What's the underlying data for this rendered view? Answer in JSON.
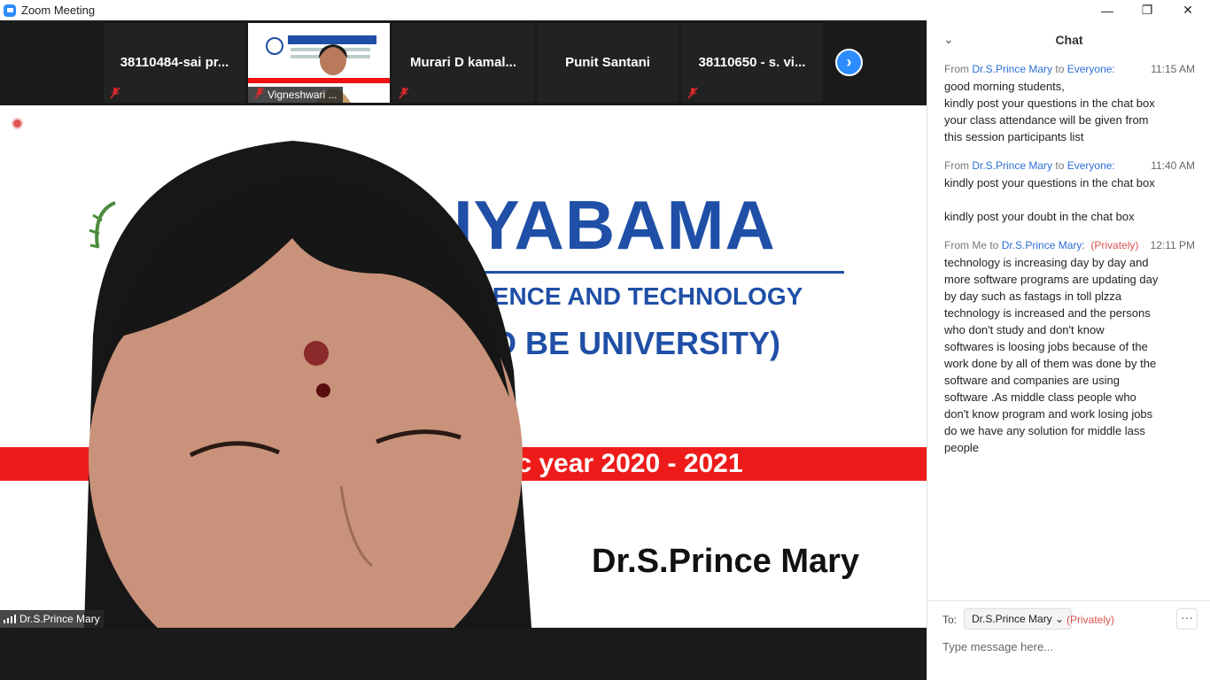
{
  "window": {
    "title": "Zoom Meeting",
    "minimize_glyph": "—",
    "maximize_glyph": "❐",
    "close_glyph": "✕"
  },
  "participants_strip": {
    "tiles": [
      {
        "name": "38110484-sai pr..."
      },
      {
        "name": "Vigneshwari ...",
        "video": true
      },
      {
        "name": "Murari  D  kamal..."
      },
      {
        "name": "Punit Santani"
      },
      {
        "name": "38110650 - s. vi..."
      }
    ],
    "next_glyph": "›"
  },
  "main_video": {
    "speaker_name": "Dr.S.Prince Mary",
    "slide": {
      "title_fragment": "IYABAMA",
      "sub1_fragment": "IENCE AND TECHNOLOGY",
      "sub2_fragment": "O BE UNIVERSITY)",
      "year_fragment": "ic year 2020 - 2021",
      "presenter": "Dr.S.Prince Mary"
    }
  },
  "chat": {
    "title": "Chat",
    "collapse_glyph": "⌄",
    "messages": [
      {
        "from_prefix": "From ",
        "sender": "Dr.S.Prince Mary",
        "to_word": " to ",
        "recipient": "Everyone:",
        "privately": "",
        "time": "11:15 AM",
        "lines": [
          "good morning students,",
          "kindly post your questions in the chat box",
          "your class attendance will be given from",
          "this session participants list"
        ]
      },
      {
        "from_prefix": "From ",
        "sender": "Dr.S.Prince Mary",
        "to_word": " to ",
        "recipient": "Everyone:",
        "privately": "",
        "time": "11:40 AM",
        "lines": [
          "kindly post your questions in the chat box",
          "",
          "kindly post your doubt in the chat box"
        ]
      },
      {
        "from_prefix": "From Me to ",
        "sender": "",
        "to_word": "",
        "recipient": "Dr.S.Prince Mary:",
        "privately": "(Privately)",
        "time": "12:11 PM",
        "lines": [
          "technology is increasing day by day and",
          "more software programs are updating day",
          "by day such as fastags in toll plzza",
          "technology is increased and the persons",
          "who don't study and don't know",
          "softwares is loosing jobs because of the",
          "work done by all of them was done by the",
          "software and companies are using",
          "software .As middle class people who",
          "don't know program and work losing jobs",
          "do we have any solution for middle lass",
          "people"
        ]
      }
    ],
    "footer": {
      "to_label": "To:",
      "recipient": "Dr.S.Prince Mary",
      "privately": "(Privately)",
      "more_glyph": "···",
      "placeholder": "Type message here..."
    }
  }
}
